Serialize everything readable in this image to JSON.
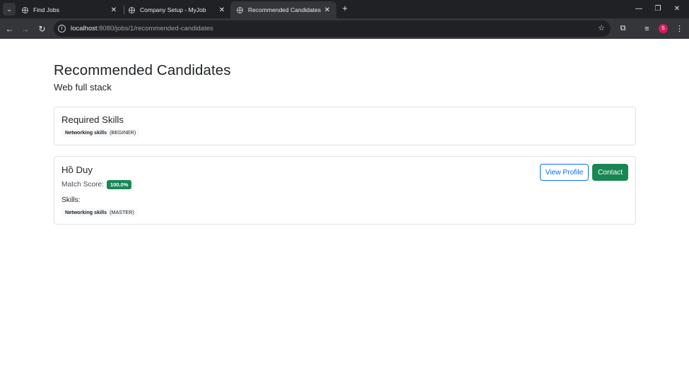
{
  "browser": {
    "tabs": [
      {
        "title": "Find Jobs",
        "active": false
      },
      {
        "title": "Company Setup - MyJob",
        "active": false
      },
      {
        "title": "Recommended Candidates",
        "active": true
      }
    ],
    "url_host": "localhost",
    "url_rest": ":8080/jobs/1/recommended-candidates",
    "profile_initial": "S",
    "colors": {
      "frame": "#202124",
      "toolbar": "#35363a",
      "profile": "#d81b60"
    }
  },
  "page": {
    "title": "Recommended Candidates",
    "job_title": "Web full stack"
  },
  "required_skills": {
    "heading": "Required Skills",
    "items": [
      {
        "name": "Networking skills",
        "level": "(BEGINER)"
      }
    ]
  },
  "candidates": [
    {
      "name": "Hồ Duy",
      "match_label": "Match Score:",
      "match_score": "100.0%",
      "skills_label": "Skills:",
      "skills": [
        {
          "name": "Networking skills",
          "level": "(MASTER)"
        }
      ],
      "view_profile_label": "View Profile",
      "contact_label": "Contact"
    }
  ],
  "colors": {
    "primary": "#0d6efd",
    "success": "#198754",
    "text": "#212529",
    "border": "#dee2e6"
  }
}
